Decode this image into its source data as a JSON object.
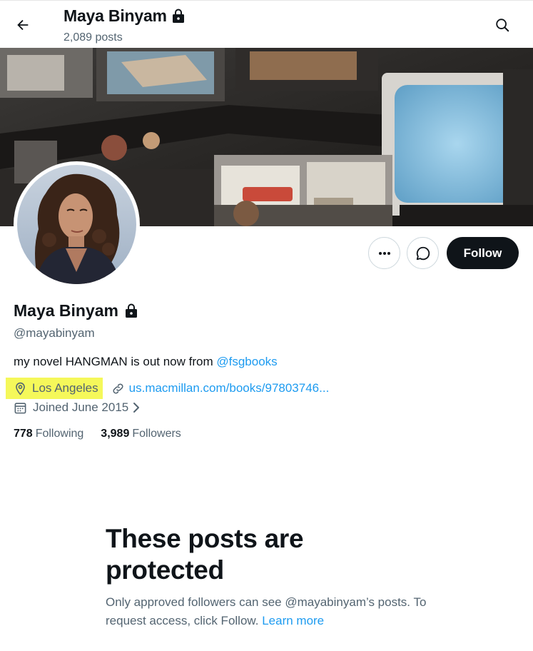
{
  "header": {
    "name": "Maya Binyam",
    "posts_count": "2,089 posts"
  },
  "profile": {
    "display_name": "Maya Binyam",
    "handle": "@mayabinyam",
    "bio_text": "my novel HANGMAN is out now from ",
    "bio_mention": "@fsgbooks",
    "location": "Los Angeles",
    "url": "us.macmillan.com/books/97803746...",
    "joined": "Joined June 2015",
    "following_count": "778",
    "following_label": "Following",
    "followers_count": "3,989",
    "followers_label": "Followers"
  },
  "actions": {
    "follow_label": "Follow"
  },
  "protected": {
    "title": "These posts are protected",
    "desc_text": "Only approved followers can see @mayabinyam’s posts. To request access, click Follow. ",
    "learn_more": "Learn more"
  },
  "colors": {
    "accent": "#1d9bf0",
    "text_primary": "#0f1419",
    "text_secondary": "#536471",
    "location_highlight": "#f5f85a"
  },
  "icons": {
    "back": "arrow-left-icon",
    "search": "search-icon",
    "lock": "lock-icon",
    "more": "more-icon",
    "message": "message-icon",
    "location": "location-pin-icon",
    "link": "link-icon",
    "calendar": "calendar-icon",
    "chevron": "chevron-right-icon"
  }
}
